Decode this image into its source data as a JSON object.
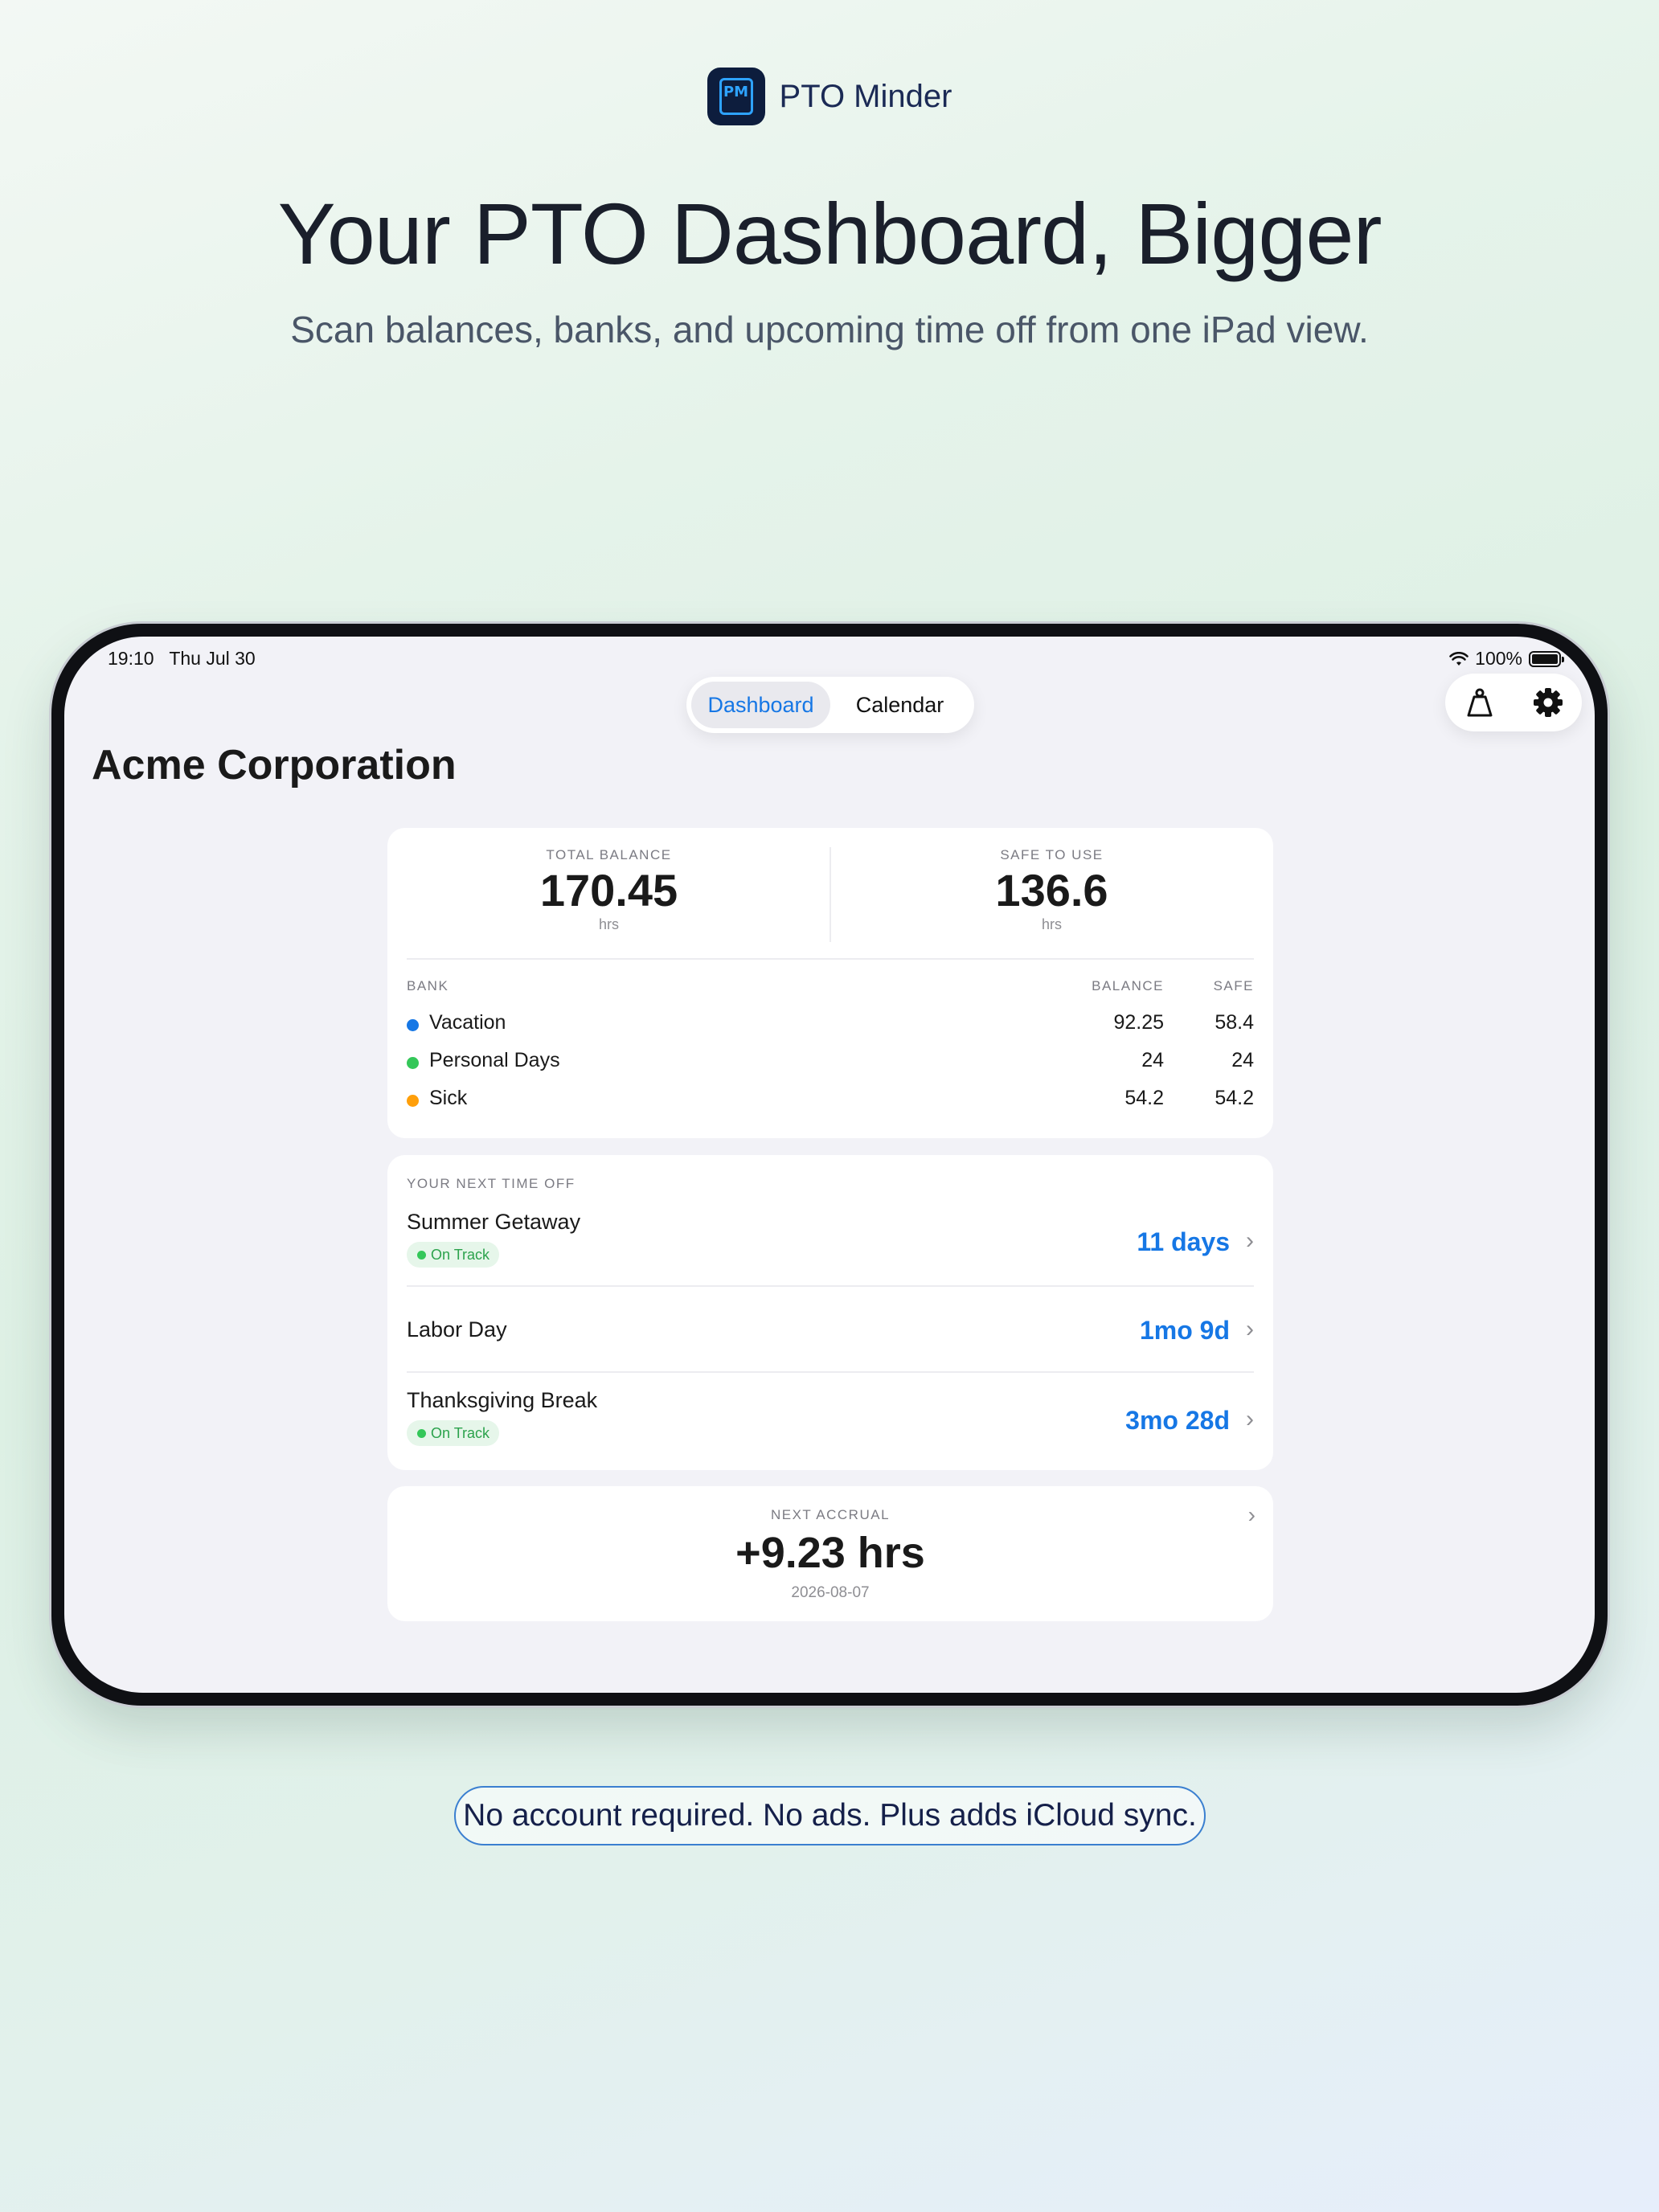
{
  "brand": {
    "logo_text": "PM",
    "name": "PTO Minder"
  },
  "hero": {
    "title": "Your PTO Dashboard, Bigger",
    "subtitle": "Scan balances, banks, and upcoming time off from one iPad view."
  },
  "status_bar": {
    "time": "19:10",
    "date": "Thu Jul 30",
    "battery": "100%"
  },
  "nav": {
    "tabs": [
      {
        "label": "Dashboard",
        "active": true
      },
      {
        "label": "Calendar",
        "active": false
      }
    ]
  },
  "toolbar": {
    "icons": [
      "tag-icon",
      "gear-icon"
    ]
  },
  "company": "Acme Corporation",
  "totals": {
    "total_label": "TOTAL BALANCE",
    "total_value": "170.45",
    "total_unit": "hrs",
    "safe_label": "SAFE TO USE",
    "safe_value": "136.6",
    "safe_unit": "hrs"
  },
  "banks": {
    "headers": {
      "bank": "BANK",
      "balance": "BALANCE",
      "safe": "SAFE"
    },
    "rows": [
      {
        "name": "Vacation",
        "balance": "92.25",
        "safe": "58.4",
        "color": "#1677e5"
      },
      {
        "name": "Personal Days",
        "balance": "24",
        "safe": "24",
        "color": "#34c759"
      },
      {
        "name": "Sick",
        "balance": "54.2",
        "safe": "54.2",
        "color": "#ff9f0a"
      }
    ]
  },
  "time_off": {
    "header": "YOUR NEXT TIME OFF",
    "items": [
      {
        "name": "Summer Getaway",
        "status": "On Track",
        "countdown": "11 days"
      },
      {
        "name": "Labor Day",
        "countdown": "1mo 9d"
      },
      {
        "name": "Thanksgiving Break",
        "status": "On Track",
        "countdown": "3mo 28d"
      }
    ]
  },
  "accrual": {
    "label": "NEXT ACCRUAL",
    "value": "+9.23 hrs",
    "date": "2026-08-07"
  },
  "footer": "No account required. No ads. Plus adds iCloud sync.",
  "colors": {
    "accent": "#1677e5",
    "on_track": "#34c759",
    "background": "#f2f2f7"
  }
}
